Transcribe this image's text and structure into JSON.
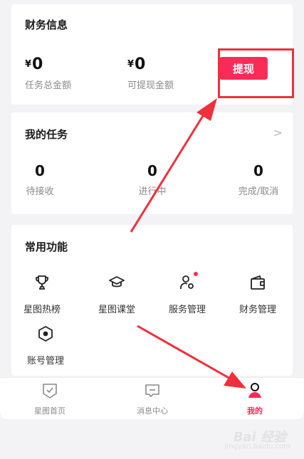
{
  "finance": {
    "title": "财务信息",
    "total_amount": {
      "currency": "¥",
      "value": "0",
      "label": "任务总金额"
    },
    "withdrawable_amount": {
      "currency": "¥",
      "value": "0",
      "label": "可提现金额"
    },
    "withdraw_button": "提现"
  },
  "tasks": {
    "title": "我的任务",
    "chevron": ">",
    "stats": [
      {
        "value": "0",
        "label": "待接收"
      },
      {
        "value": "0",
        "label": "进行中"
      },
      {
        "value": "0",
        "label": "完成/取消"
      }
    ]
  },
  "features": {
    "title": "常用功能",
    "items": [
      {
        "label": "星图热榜",
        "icon": "trophy-icon"
      },
      {
        "label": "星图课堂",
        "icon": "graduation-cap-icon"
      },
      {
        "label": "服务管理",
        "icon": "user-gear-icon",
        "badge": true
      },
      {
        "label": "财务管理",
        "icon": "wallet-icon"
      },
      {
        "label": "账号管理",
        "icon": "hexagon-settings-icon"
      }
    ]
  },
  "tabbar": {
    "tabs": [
      {
        "label": "星图首页",
        "icon": "shield-check-icon",
        "active": false
      },
      {
        "label": "消息中心",
        "icon": "message-icon",
        "active": false
      },
      {
        "label": "我的",
        "icon": "person-icon",
        "active": true
      }
    ]
  },
  "watermark": {
    "brand": "Bai 经验",
    "url": "jingyan.baidu.com"
  },
  "colors": {
    "accent": "#fb2b57",
    "annotation": "#f02f3c",
    "background": "#f3f3f5"
  }
}
